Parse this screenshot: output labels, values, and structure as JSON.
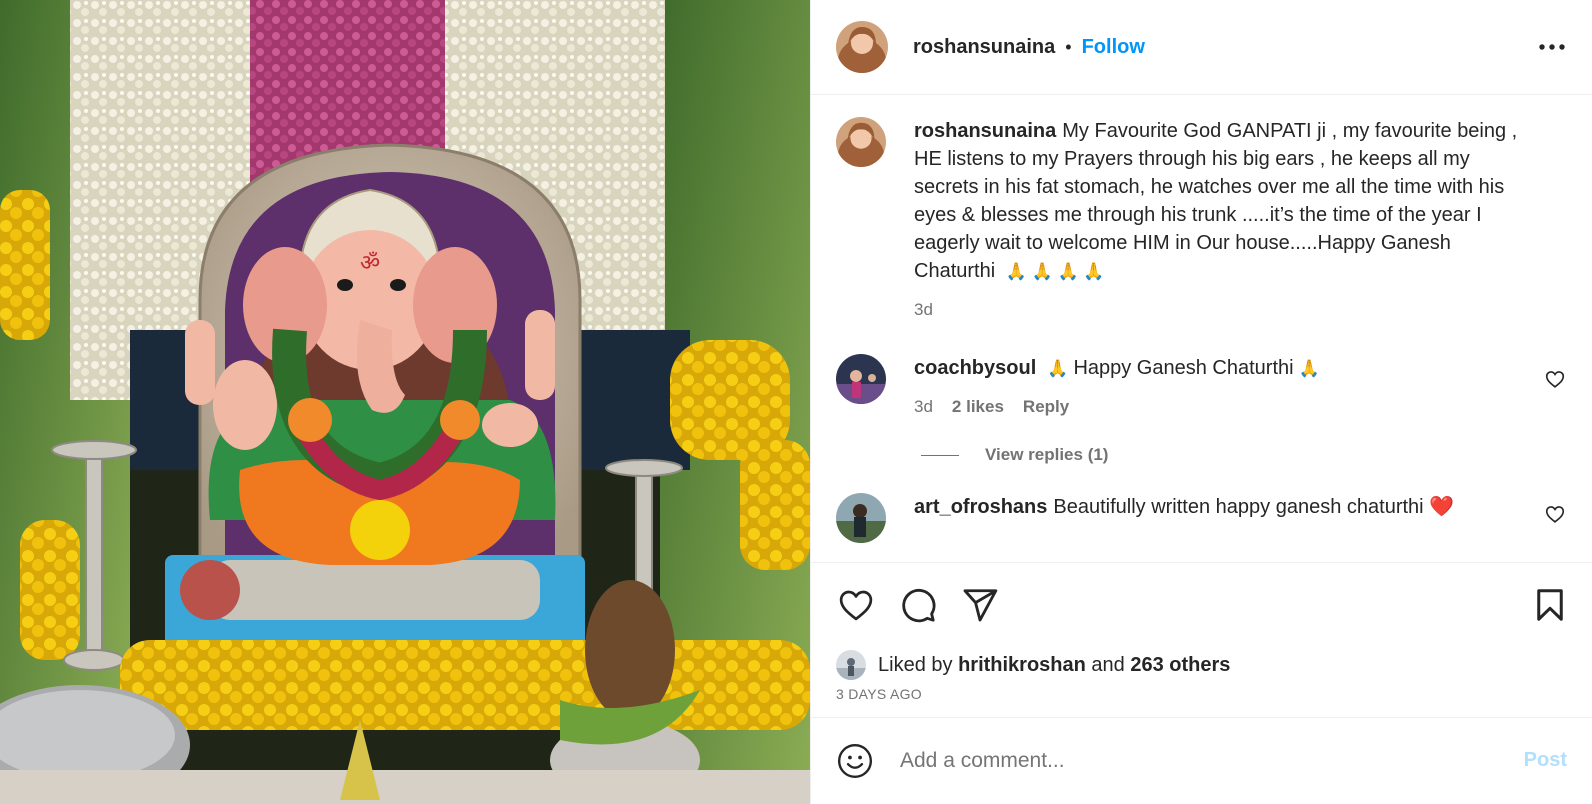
{
  "post": {
    "username": "roshansunaina",
    "separator": "•",
    "follow_label": "Follow",
    "caption": "My Favourite God GANPATI ji , my favourite being , HE listens to my Prayers through his big ears , he keeps all my secrets in his fat stomach, he watches over me all the time with his eyes & blesses me through his trunk .....it’s the time of the year I eagerly wait to welcome HIM in Our house.....Happy Ganesh Chaturthi",
    "caption_emoji": "🙏 🙏 🙏 🙏",
    "caption_time": "3d"
  },
  "comments": [
    {
      "username": "coachbysoul",
      "emoji_before": "🙏",
      "text": "Happy Ganesh Chaturthi",
      "emoji_after": "🙏",
      "time": "3d",
      "likes": "2 likes",
      "reply_label": "Reply",
      "view_replies": "View replies (1)"
    },
    {
      "username": "art_ofroshans",
      "text": "Beautifully written happy ganesh chaturthi",
      "emoji_after": "❤️"
    }
  ],
  "likes": {
    "prefix": "Liked by",
    "user": "hrithikroshan",
    "middle": "and",
    "others": "263 others"
  },
  "date_label": "3 DAYS AGO",
  "add_comment": {
    "placeholder": "Add a comment...",
    "post_label": "Post"
  },
  "colors": {
    "accent": "#0095f6",
    "post_disabled": "#b2dffc",
    "muted": "#737373"
  },
  "icons": [
    "more-icon",
    "heart-icon",
    "comment-icon",
    "share-icon",
    "bookmark-icon",
    "emoji-icon"
  ]
}
